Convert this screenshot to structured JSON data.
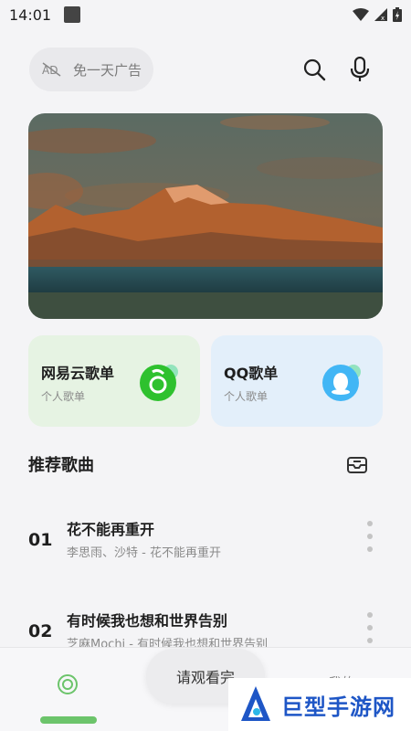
{
  "status_bar": {
    "time": "14:01"
  },
  "header": {
    "ad_pill": {
      "label": "免一天广告",
      "icon": "ad-off-icon"
    },
    "search_icon": "search-icon",
    "mic_icon": "mic-icon"
  },
  "banner": {
    "description_icon": "mountain-banner-image"
  },
  "cards": [
    {
      "title": "网易云歌单",
      "subtitle": "个人歌单",
      "icon": "netease-logo-icon",
      "color": "#2ec12e"
    },
    {
      "title": "QQ歌单",
      "subtitle": "个人歌单",
      "icon": "qq-logo-icon",
      "color": "#42b6f5"
    }
  ],
  "recommend": {
    "title": "推荐歌曲",
    "songs": [
      {
        "num": "01",
        "title": "花不能再重开",
        "subtitle": "李思雨、沙特 - 花不能再重开"
      },
      {
        "num": "02",
        "title": "有时候我也想和世界告别",
        "subtitle": "芝麻Mochi - 有时候我也想和世界告别"
      }
    ]
  },
  "toast": {
    "text": "请观看完"
  },
  "bottom_nav": {
    "mine_label": "我的"
  },
  "watermark": {
    "text": "巨型手游网"
  },
  "colors": {
    "accent_green": "#6cc46b",
    "watermark_blue": "#1e56c6"
  }
}
